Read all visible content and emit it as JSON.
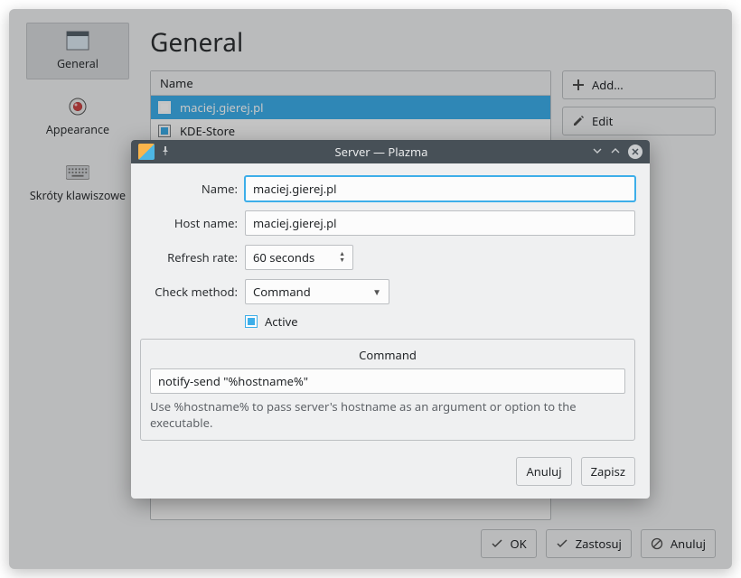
{
  "sidebar": {
    "items": [
      {
        "label": "General"
      },
      {
        "label": "Appearance"
      },
      {
        "label": "Skróty klawiszowe"
      }
    ]
  },
  "page": {
    "title": "General"
  },
  "list": {
    "header": "Name",
    "rows": [
      {
        "label": "maciej.gierej.pl"
      },
      {
        "label": "KDE-Store"
      }
    ]
  },
  "side_buttons": {
    "add": "Add...",
    "edit": "Edit"
  },
  "bottom": {
    "ok": "OK",
    "apply": "Zastosuj",
    "cancel": "Anuluj"
  },
  "dialog": {
    "title": "Server — Plazma",
    "form": {
      "name_label": "Name:",
      "name_value": "maciej.gierej.pl",
      "host_label": "Host name:",
      "host_value": "maciej.gierej.pl",
      "refresh_label": "Refresh rate:",
      "refresh_value": "60 seconds",
      "method_label": "Check method:",
      "method_value": "Command",
      "active_label": "Active"
    },
    "command": {
      "legend": "Command",
      "value": "notify-send \"%hostname%\"",
      "hint": "Use %hostname% to pass server's hostname as an argument or option to the executable."
    },
    "buttons": {
      "cancel": "Anuluj",
      "save": "Zapisz"
    }
  }
}
